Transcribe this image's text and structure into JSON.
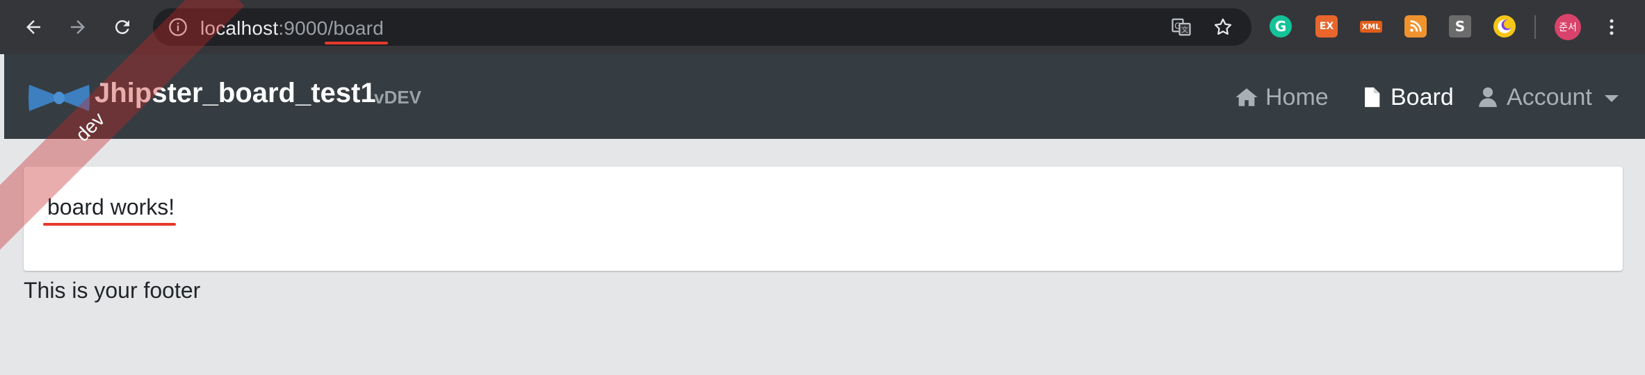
{
  "browser": {
    "url_host": "localhost",
    "url_port": ":9000",
    "url_path": "/board",
    "extensions": [
      {
        "name": "grammarly",
        "label": "G",
        "color": "#15c39a"
      },
      {
        "name": "ex",
        "label": "EX",
        "color": "#e8662c"
      },
      {
        "name": "xml",
        "label": "XML",
        "color": "#e05d1a"
      },
      {
        "name": "rss",
        "label": "",
        "color": "#f0932e"
      },
      {
        "name": "s",
        "label": "S",
        "color": "#6b6b6b"
      },
      {
        "name": "crescent",
        "label": "",
        "color": "#f5c518"
      },
      {
        "name": "profile",
        "label": "준서",
        "color": "#d9436b"
      }
    ]
  },
  "app": {
    "brand_title": "Jhipster_board_test1",
    "brand_version": "vDEV",
    "ribbon": "dev",
    "menu": {
      "home": "Home",
      "board": "Board",
      "account": "Account"
    },
    "card_text": "board works!",
    "footer": "This is your footer"
  }
}
